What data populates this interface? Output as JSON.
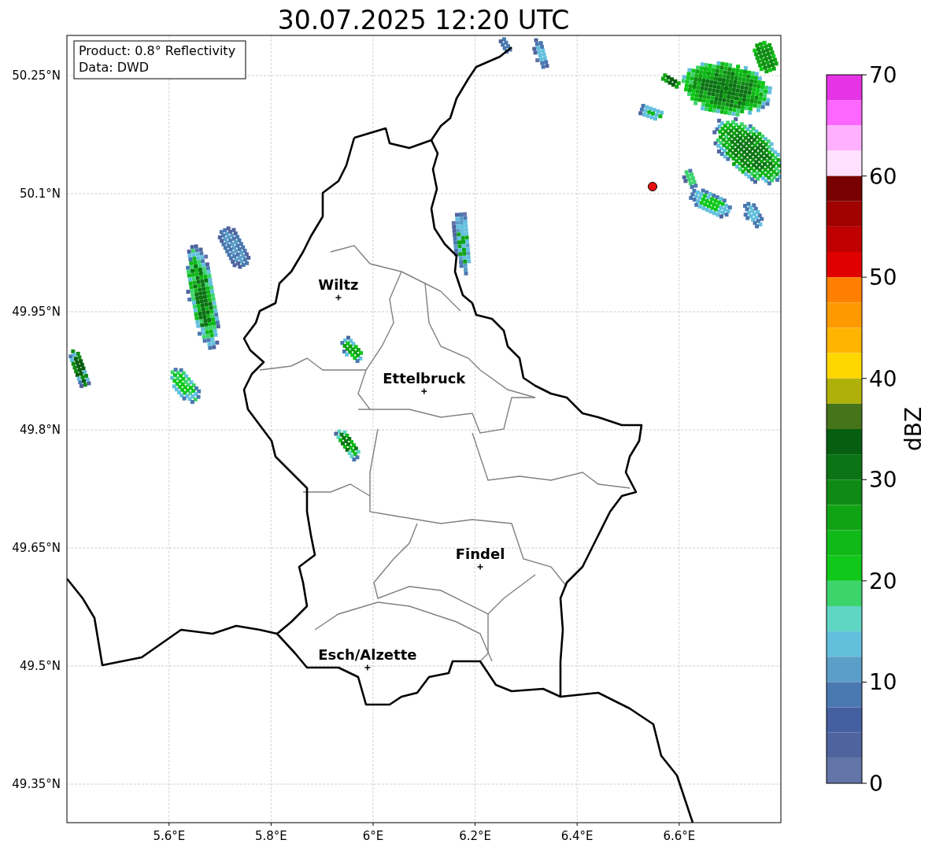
{
  "title": "30.07.2025 12:20 UTC",
  "info_box": [
    "Product: 0.8° Reflectivity",
    "Data: DWD"
  ],
  "x_ticks": [
    "5.6°E",
    "5.8°E",
    "6°E",
    "6.2°E",
    "6.4°E",
    "6.6°E"
  ],
  "y_ticks": [
    "50.25°N",
    "50.1°N",
    "49.95°N",
    "49.8°N",
    "49.65°N",
    "49.5°N",
    "49.35°N"
  ],
  "cities": [
    {
      "name": "Wiltz"
    },
    {
      "name": "Ettelbruck"
    },
    {
      "name": "Findel"
    },
    {
      "name": "Esch/Alzette"
    }
  ],
  "colorbar": {
    "ticks": [
      "70",
      "60",
      "50",
      "40",
      "30",
      "20",
      "10",
      "0"
    ],
    "label": "dBZ",
    "bins": [
      {
        "color": "#e633e6"
      },
      {
        "color": "#ff66ff"
      },
      {
        "color": "#ffb0ff"
      },
      {
        "color": "#ffe0ff"
      },
      {
        "color": "#780000"
      },
      {
        "color": "#a00000"
      },
      {
        "color": "#c00000"
      },
      {
        "color": "#e00000"
      },
      {
        "color": "#ff7f00"
      },
      {
        "color": "#ff9900"
      },
      {
        "color": "#ffb400"
      },
      {
        "color": "#ffd700"
      },
      {
        "color": "#b0b00a"
      },
      {
        "color": "#45741a"
      },
      {
        "color": "#065e10"
      },
      {
        "color": "#0b7414"
      },
      {
        "color": "#0f8a14"
      },
      {
        "color": "#10a414"
      },
      {
        "color": "#10b818"
      },
      {
        "color": "#10c81a"
      },
      {
        "color": "#3dd46c"
      },
      {
        "color": "#5fd6c4"
      },
      {
        "color": "#63c0dd"
      },
      {
        "color": "#5b9ec8"
      },
      {
        "color": "#4a78b0"
      },
      {
        "color": "#4560a0"
      },
      {
        "color": "#4f649e"
      },
      {
        "color": "#6374a8"
      }
    ]
  }
}
